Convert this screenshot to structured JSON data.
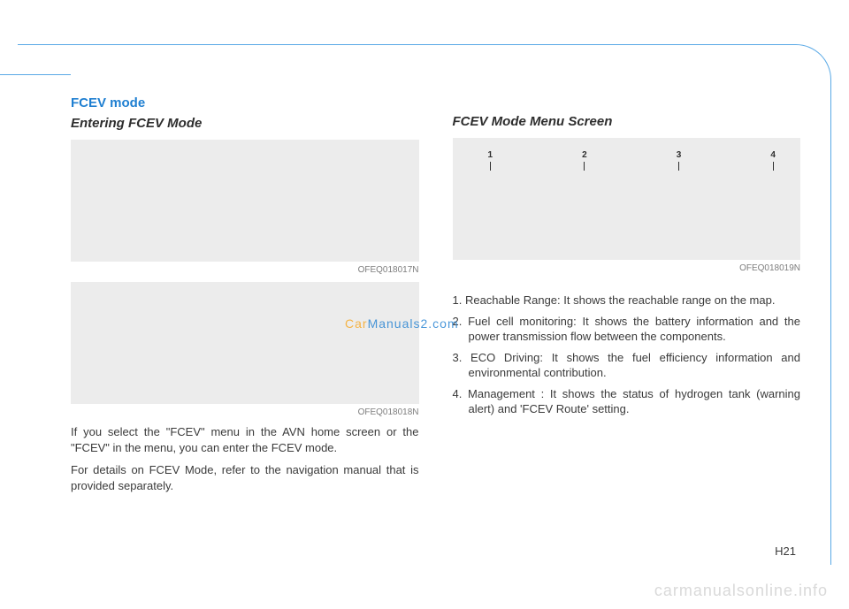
{
  "pageNumber": "H21",
  "sectionTitle": "FCEV mode",
  "left": {
    "subtitle": "Entering FCEV Mode",
    "img1Caption": "OFEQ018017N",
    "img2Caption": "OFEQ018018N",
    "para1": "If you select the \"FCEV\" menu in the AVN home screen or the \"FCEV\" in the menu, you can enter the FCEV mode.",
    "para2": "For details on FCEV Mode, refer to the navigation manual that is provided separately."
  },
  "right": {
    "subtitle": "FCEV Mode Menu Screen",
    "imgCaption": "OFEQ018019N",
    "markers": [
      "1",
      "2",
      "3",
      "4"
    ],
    "items": [
      "1. Reachable Range: It shows the reachable range on the map.",
      "2. Fuel cell monitoring: It shows the battery information and the power transmission flow between the components.",
      "3. ECO Driving: It shows the fuel efficiency information and environmental contribution.",
      "4. Management : It shows the status of hydrogen tank (warning alert) and 'FCEV Route' setting."
    ]
  },
  "watermarkMid": {
    "prefix": "Car",
    "rest": "Manuals2.com"
  },
  "watermarkFooter": "carmanualsonline.info"
}
